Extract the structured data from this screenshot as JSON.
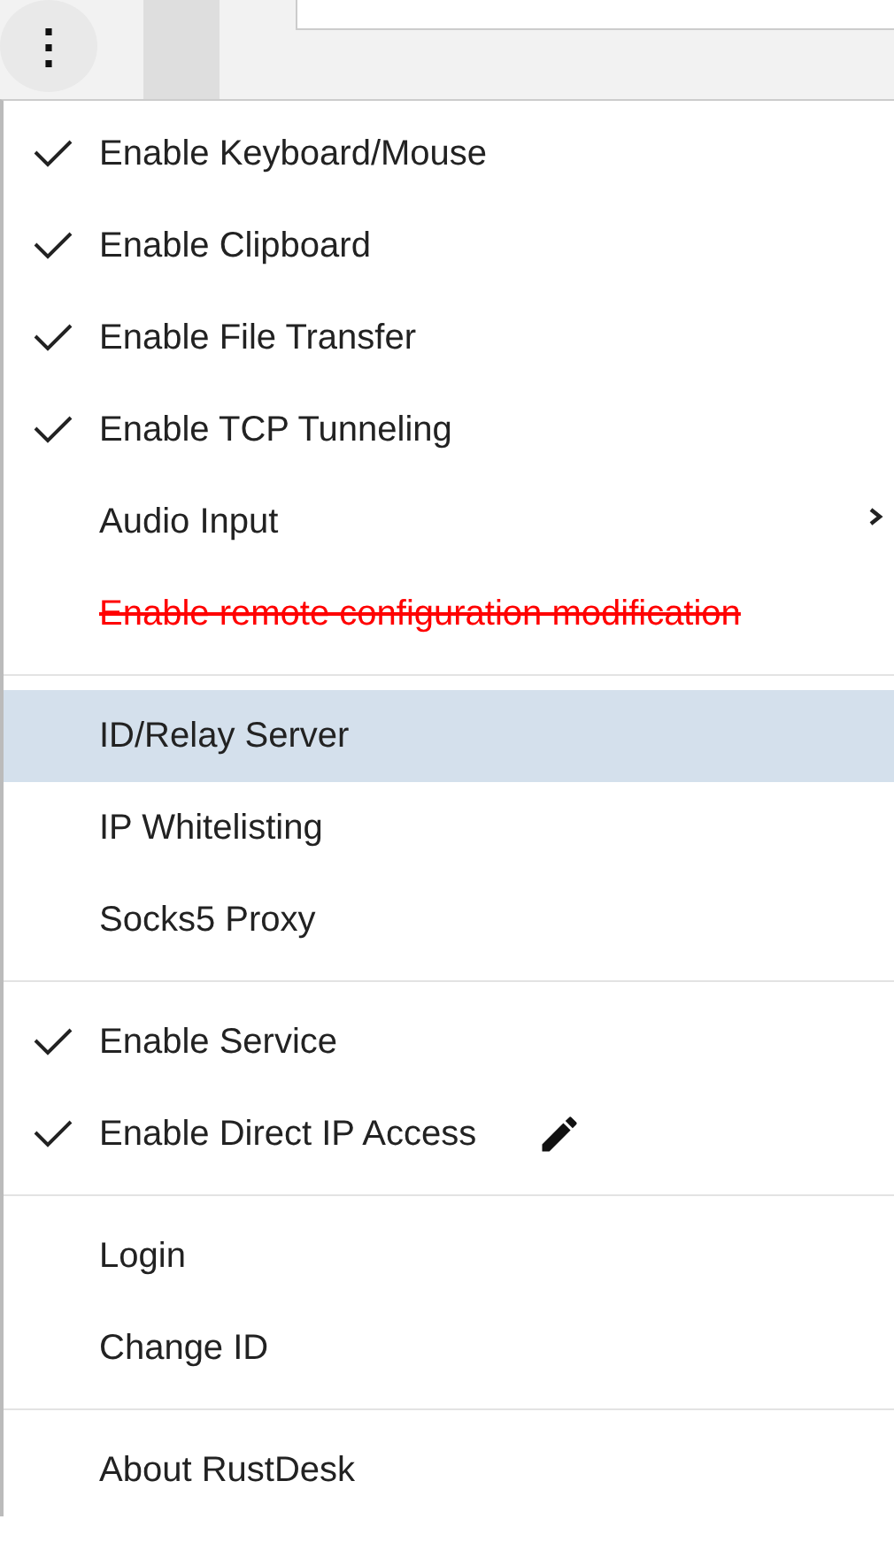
{
  "menu_button": {
    "label": "⋮"
  },
  "menu": {
    "groups": [
      {
        "items": [
          {
            "label": "Enable Keyboard/Mouse",
            "kind": "check",
            "checked": true,
            "selected": false
          },
          {
            "label": "Enable Clipboard",
            "kind": "check",
            "checked": true,
            "selected": false
          },
          {
            "label": "Enable File Transfer",
            "kind": "check",
            "checked": true,
            "selected": false
          },
          {
            "label": "Enable TCP Tunneling",
            "kind": "check",
            "checked": true,
            "selected": false
          },
          {
            "label": "Audio Input",
            "kind": "submenu",
            "checked": false,
            "selected": false
          },
          {
            "label": "Enable remote configuration modification",
            "kind": "blocked",
            "checked": false,
            "selected": false
          }
        ]
      },
      {
        "items": [
          {
            "label": "ID/Relay Server",
            "kind": "plain",
            "checked": false,
            "selected": true
          },
          {
            "label": "IP Whitelisting",
            "kind": "plain",
            "checked": false,
            "selected": false
          },
          {
            "label": "Socks5 Proxy",
            "kind": "plain",
            "checked": false,
            "selected": false
          }
        ]
      },
      {
        "items": [
          {
            "label": "Enable Service",
            "kind": "check",
            "checked": true,
            "selected": false
          },
          {
            "label": "Enable Direct IP Access",
            "kind": "editable",
            "checked": true,
            "selected": false
          }
        ]
      },
      {
        "items": [
          {
            "label": "Login",
            "kind": "plain",
            "checked": false,
            "selected": false
          },
          {
            "label": "Change ID",
            "kind": "plain",
            "checked": false,
            "selected": false
          }
        ]
      },
      {
        "items": [
          {
            "label": "About RustDesk",
            "kind": "plain",
            "checked": false,
            "selected": false
          }
        ]
      }
    ]
  }
}
